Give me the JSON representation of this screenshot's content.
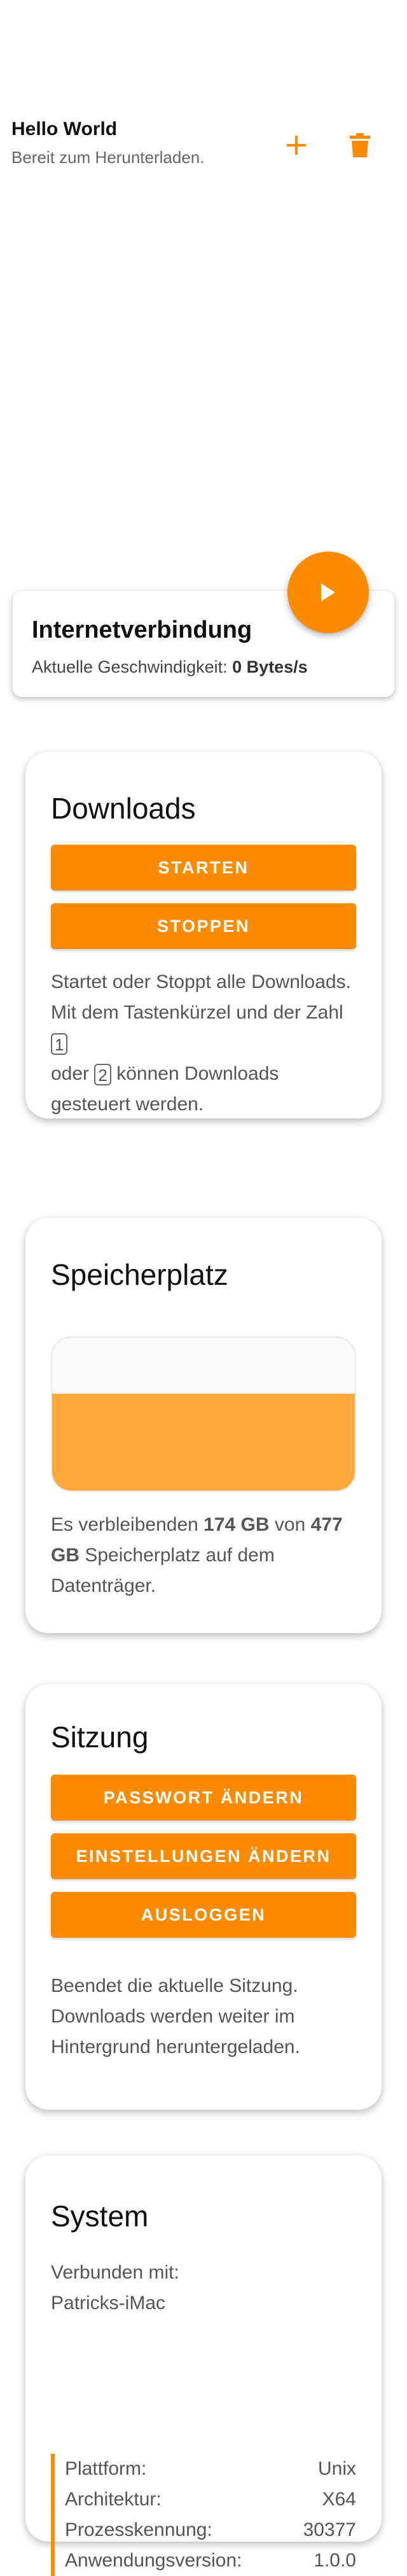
{
  "download_item": {
    "title": "Hello World",
    "status": "Bereit zum Herunterladen."
  },
  "connection": {
    "title": "Internetverbindung",
    "speed_label": "Aktuelle Geschwindigkeit: ",
    "speed_value": "0 Bytes/s"
  },
  "downloads_card": {
    "title": "Downloads",
    "start_label": "Starten",
    "stop_label": "Stoppen",
    "text_1": "Startet oder Stoppt alle Downloads. Mit dem Tastenkürzel und der Zahl",
    "key_1": "1",
    "text_2": "oder",
    "key_2": "2",
    "text_3": "können Downloads gesteuert werden."
  },
  "storage_card": {
    "title": "Speicherplatz",
    "free_fraction": 0.635,
    "text_1": "Es verbleibenden ",
    "free": "174 GB",
    "text_2": " von ",
    "total": "477 GB",
    "text_3": " Speicherplatz auf dem Datenträger."
  },
  "session_card": {
    "title": "Sitzung",
    "change_password_label": "Passwort ändern",
    "change_settings_label": "Einstellungen ändern",
    "logout_label": "Ausloggen",
    "text": "Beendet die aktuelle Sitzung. Downloads werden weiter im Hintergrund heruntergeladen."
  },
  "system_card": {
    "title": "System",
    "connected_label": "Verbunden mit:",
    "host": "Patricks-iMac",
    "rows": [
      {
        "label": "Plattform:",
        "value": "Unix"
      },
      {
        "label": "Architektur:",
        "value": "X64"
      },
      {
        "label": "Prozesskennung:",
        "value": "30377"
      },
      {
        "label": "Anwendungsversion:",
        "value": "1.0.0"
      }
    ]
  },
  "colors": {
    "accent": "#fb8c00",
    "storage_fill": "#ffa940"
  },
  "icons": {
    "add": "plus-icon",
    "delete": "trash-icon",
    "play": "play-icon"
  }
}
